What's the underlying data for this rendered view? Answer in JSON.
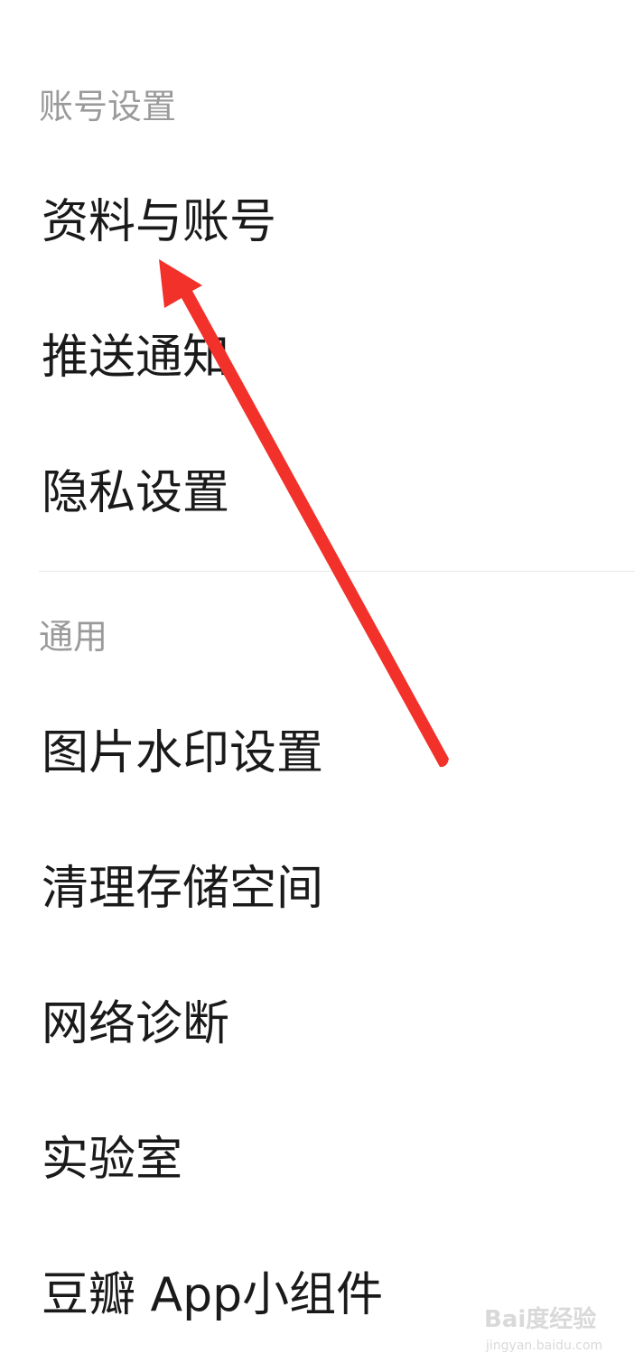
{
  "sections": [
    {
      "header": "账号设置",
      "items": [
        {
          "label": "资料与账号"
        },
        {
          "label": "推送通知"
        },
        {
          "label": "隐私设置"
        }
      ]
    },
    {
      "header": "通用",
      "items": [
        {
          "label": "图片水印设置"
        },
        {
          "label": "清理存储空间"
        },
        {
          "label": "网络诊断"
        },
        {
          "label": "实验室"
        },
        {
          "label": "豆瓣 App小组件"
        }
      ]
    }
  ],
  "annotation": {
    "arrow_color": "#f2312a"
  },
  "watermark": {
    "brand": "Bai度经验",
    "url": "jingyan.baidu.com",
    "color": "#d9d9d9"
  }
}
